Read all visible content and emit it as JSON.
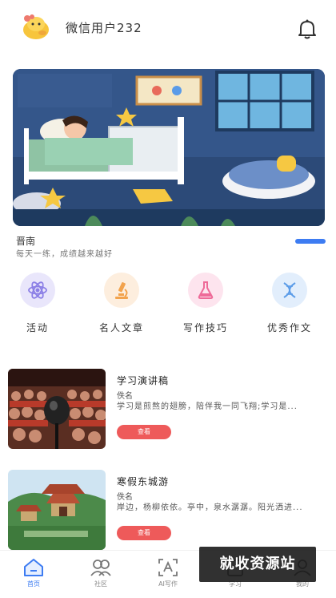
{
  "header": {
    "username": "微信用户232"
  },
  "banner": {
    "caption_title": "晋南",
    "caption_subtitle": "每天一练，成绩越来越好"
  },
  "categories": [
    {
      "label": "活动",
      "icon": "atom-icon",
      "bg": "#e9e6fb",
      "fg": "#8b7fe6"
    },
    {
      "label": "名人文章",
      "icon": "microscope-icon",
      "bg": "#fdeede",
      "fg": "#f2a34d"
    },
    {
      "label": "写作技巧",
      "icon": "flask-icon",
      "bg": "#fde4ee",
      "fg": "#ee6a98"
    },
    {
      "label": "优秀作文",
      "icon": "dna-icon",
      "bg": "#e2eefc",
      "fg": "#5a9be8"
    }
  ],
  "articles": [
    {
      "title": "学习演讲稿",
      "author": "佚名",
      "excerpt": "学习是煎熬的翅膀，陪伴我一同飞翔;学习是...",
      "button": "查看"
    },
    {
      "title": "寒假东城游",
      "author": "佚名",
      "excerpt": "岸边，杨柳依依。亭中，泉水潺潺。阳光洒进...",
      "button": "查看"
    }
  ],
  "bottom_nav": [
    {
      "label": "首页",
      "icon": "home-icon",
      "active": true
    },
    {
      "label": "社区",
      "icon": "community-icon",
      "active": false
    },
    {
      "label": "AI写作",
      "icon": "ai-writing-icon",
      "active": false
    },
    {
      "label": "学习",
      "icon": "study-icon",
      "active": false
    },
    {
      "label": "我的",
      "icon": "profile-icon",
      "active": false
    }
  ],
  "watermark": "就收资源站",
  "colors": {
    "accent": "#3d7cf2",
    "button_red": "#ee5a5a"
  }
}
